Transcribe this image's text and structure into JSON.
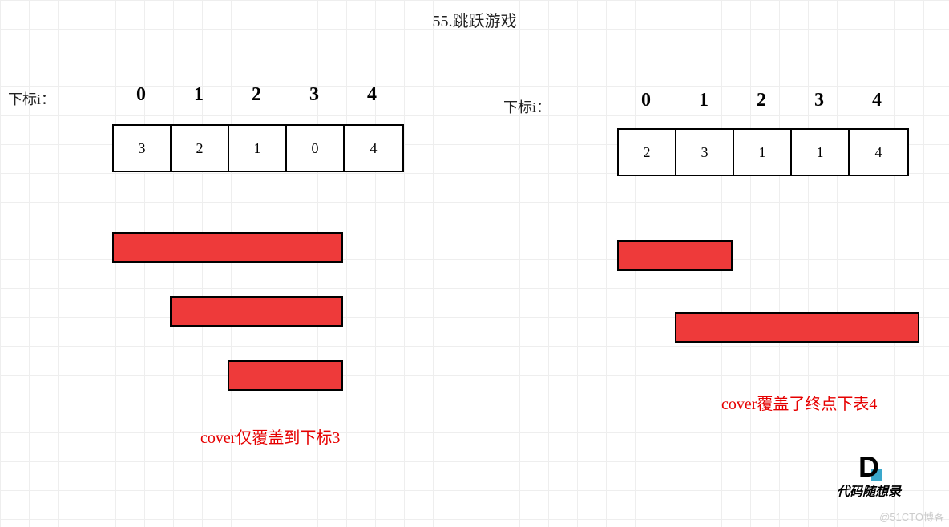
{
  "title": "55.跳跃游戏",
  "left": {
    "indexLabel": "下标i：",
    "indices": [
      "0",
      "1",
      "2",
      "3",
      "4"
    ],
    "array": [
      "3",
      "2",
      "1",
      "0",
      "4"
    ],
    "caption": "cover仅覆盖到下标3"
  },
  "right": {
    "indexLabel": "下标i：",
    "indices": [
      "0",
      "1",
      "2",
      "3",
      "4"
    ],
    "array": [
      "2",
      "3",
      "1",
      "1",
      "4"
    ],
    "caption": "cover覆盖了终点下表4"
  },
  "logo": {
    "letter": "D",
    "text": "代码随想录"
  },
  "watermark": "@51CTO博客",
  "chart_data": [
    {
      "type": "table",
      "title": "Example 1 — cannot reach end",
      "indices": [
        0,
        1,
        2,
        3,
        4
      ],
      "array": [
        3,
        2,
        1,
        0,
        4
      ],
      "cover_bars": [
        {
          "from": 0,
          "to": 3
        },
        {
          "from": 1,
          "to": 3
        },
        {
          "from": 2,
          "to": 3
        }
      ],
      "note": "cover仅覆盖到下标3"
    },
    {
      "type": "table",
      "title": "Example 2 — reaches end",
      "indices": [
        0,
        1,
        2,
        3,
        4
      ],
      "array": [
        2,
        3,
        1,
        1,
        4
      ],
      "cover_bars": [
        {
          "from": 0,
          "to": 2
        },
        {
          "from": 1,
          "to": 4
        }
      ],
      "note": "cover覆盖了终点下表4"
    }
  ]
}
